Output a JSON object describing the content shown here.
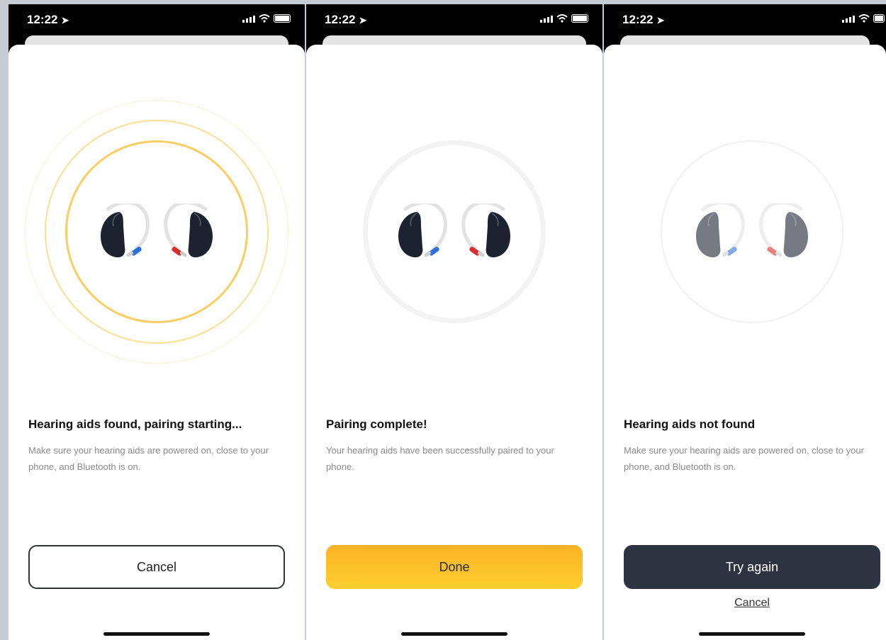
{
  "status": {
    "time": "12:22"
  },
  "screens": [
    {
      "title": "Hearing aids found, pairing starting...",
      "description": "Make sure your hearing aids are powered on, close to your phone, and Bluetooth is on.",
      "primary_button": "Cancel"
    },
    {
      "title": "Pairing complete!",
      "description": "Your hearing aids have been successfully paired to your phone.",
      "primary_button": "Done"
    },
    {
      "title": "Hearing aids not found",
      "description": "Make sure your hearing aids are powered on, close to your phone, and Bluetooth is on.",
      "primary_button": "Try again",
      "secondary_link": "Cancel"
    }
  ],
  "colors": {
    "accent_yellow": "#fcc12c",
    "dark_button": "#2d3340",
    "left_tip": "#2f6fd8",
    "right_tip": "#d82e2e"
  },
  "icons": [
    "hearing-aids-icon",
    "location-arrow-icon",
    "signal-icon",
    "wifi-icon",
    "battery-icon"
  ]
}
